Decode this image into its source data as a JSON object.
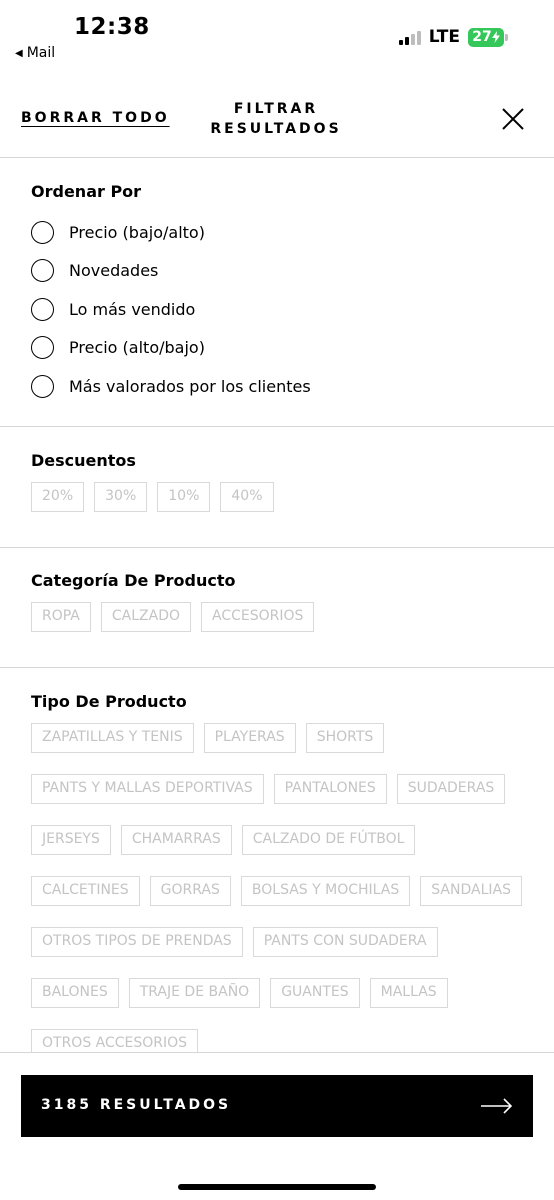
{
  "status_bar": {
    "time": "12:38",
    "back_label": "Mail",
    "network": "LTE",
    "battery": "27"
  },
  "header": {
    "clear_all": "BORRAR TODO",
    "title_line1": "FILTRAR",
    "title_line2": "RESULTADOS"
  },
  "sort": {
    "title": "Ordenar Por",
    "options": [
      "Precio (bajo/alto)",
      "Novedades",
      "Lo más vendido",
      "Precio (alto/bajo)",
      "Más valorados por los clientes"
    ]
  },
  "discounts": {
    "title": "Descuentos",
    "options": [
      "20%",
      "30%",
      "10%",
      "40%"
    ]
  },
  "category": {
    "title": "Categoría De Producto",
    "options": [
      "ROPA",
      "CALZADO",
      "ACCESORIOS"
    ]
  },
  "product_type": {
    "title": "Tipo De Producto",
    "options": [
      "ZAPATILLAS Y TENIS",
      "PLAYERAS",
      "SHORTS",
      "PANTS Y MALLAS DEPORTIVAS",
      "PANTALONES",
      "SUDADERAS",
      "JERSEYS",
      "CHAMARRAS",
      "CALZADO DE FÚTBOL",
      "CALCETINES",
      "GORRAS",
      "BOLSAS Y MOCHILAS",
      "SANDALIAS",
      "OTROS TIPOS DE PRENDAS",
      "PANTS CON SUDADERA",
      "BALONES",
      "TRAJE DE BAÑO",
      "GUANTES",
      "MALLAS",
      "OTROS ACCESORIOS"
    ]
  },
  "footer": {
    "results_label": "3185 RESULTADOS"
  },
  "colors": {
    "battery": "#35c759",
    "chip_border": "#d9d9d9",
    "chip_text": "#c4c4c4",
    "divider": "#d6d6d6"
  }
}
